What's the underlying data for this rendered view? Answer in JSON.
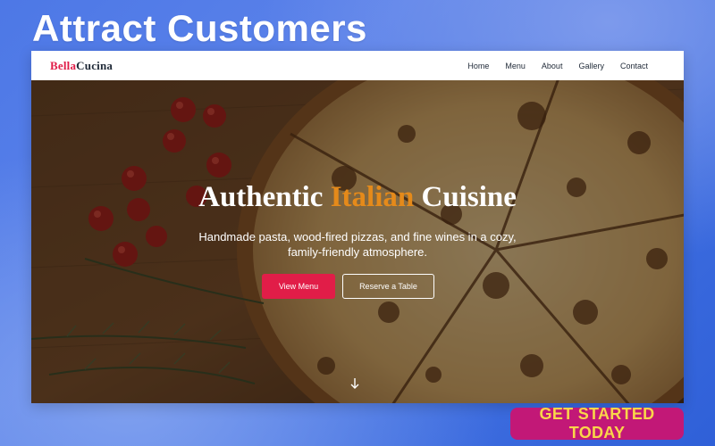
{
  "banner": {
    "headline": "Attract Customers",
    "cta_label": "GET STARTED TODAY"
  },
  "site": {
    "logo": {
      "part1": "Bella",
      "part2": "Cucina"
    },
    "nav": [
      "Home",
      "Menu",
      "About",
      "Gallery",
      "Contact"
    ]
  },
  "hero": {
    "title_part1": "Authentic ",
    "title_accent": "Italian",
    "title_part2": " Cuisine",
    "subtitle": "Handmade pasta, wood-fired pizzas, and fine wines in a cozy, family-friendly atmosphere.",
    "primary_button": "View Menu",
    "secondary_button": "Reserve a Table"
  },
  "colors": {
    "brand": "#e11d48",
    "accent": "#e58a1a",
    "cta_bg": "#c21877",
    "cta_text": "#f9d64a"
  },
  "icons": {
    "scroll": "arrow-down-icon"
  }
}
